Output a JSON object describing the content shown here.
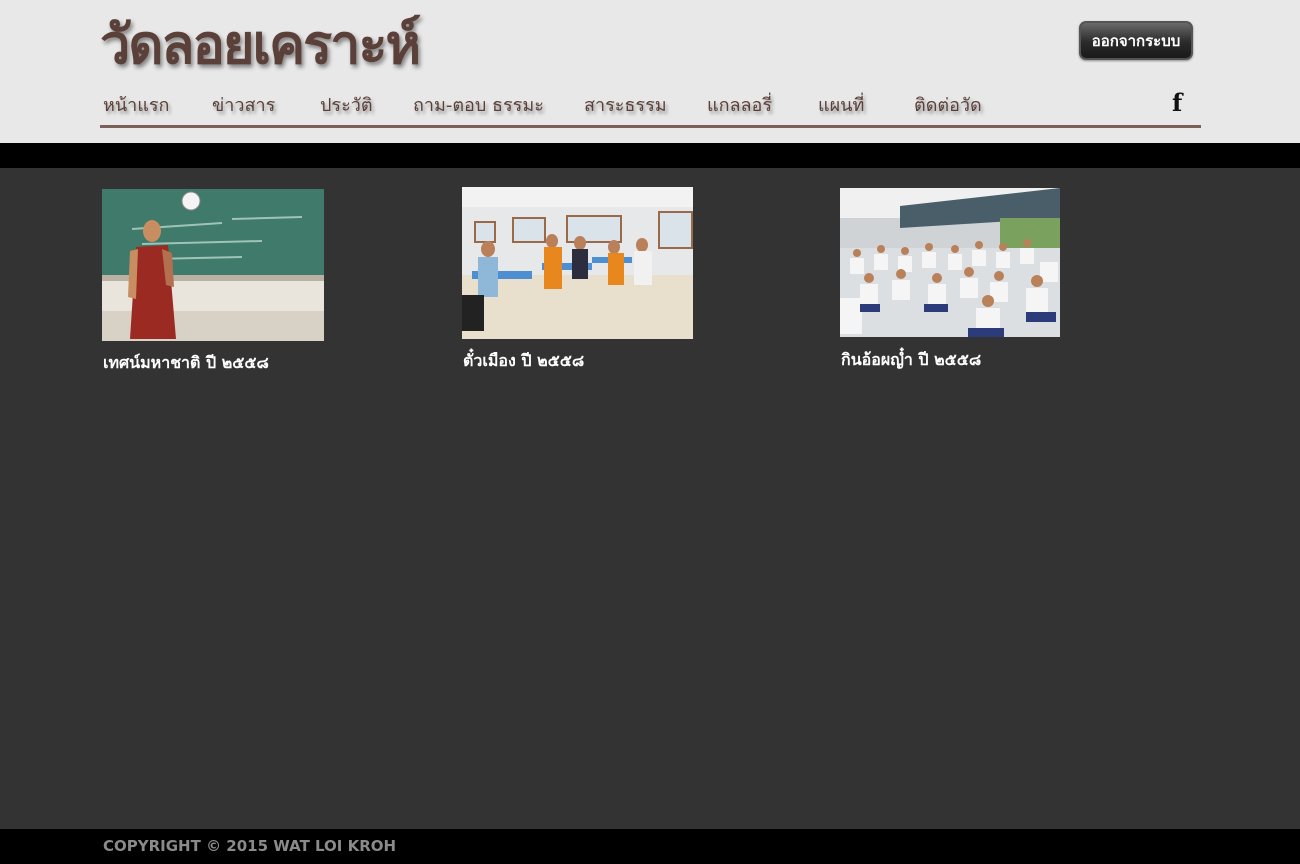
{
  "header": {
    "site_title": "วัดลอยเคราะห์",
    "logout_label": "ออกจากระบบ",
    "nav": [
      "หน้าแรก",
      "ข่าวสาร",
      "ประวัติ",
      "ถาม-ตอบ ธรรมะ",
      "สาระธรรม",
      "แกลลอรี่",
      "แผนที่",
      "ติดต่อวัด"
    ],
    "social_icon": "facebook-icon"
  },
  "gallery": [
    {
      "caption": "เทศน์มหาชาติ ปี ๒๕๕๘"
    },
    {
      "caption": "ตั๋วเมือง ปี ๒๕๕๘"
    },
    {
      "caption": "กินอ้อผญ๋ำ ปี ๒๕๕๘"
    }
  ],
  "footer": {
    "copyright": "COPYRIGHT © 2015 WAT LOI KROH"
  },
  "colors": {
    "header_bg": "#e8e8e8",
    "brand_brown": "#5a4038",
    "content_bg": "#333333",
    "band_black": "#000000"
  }
}
